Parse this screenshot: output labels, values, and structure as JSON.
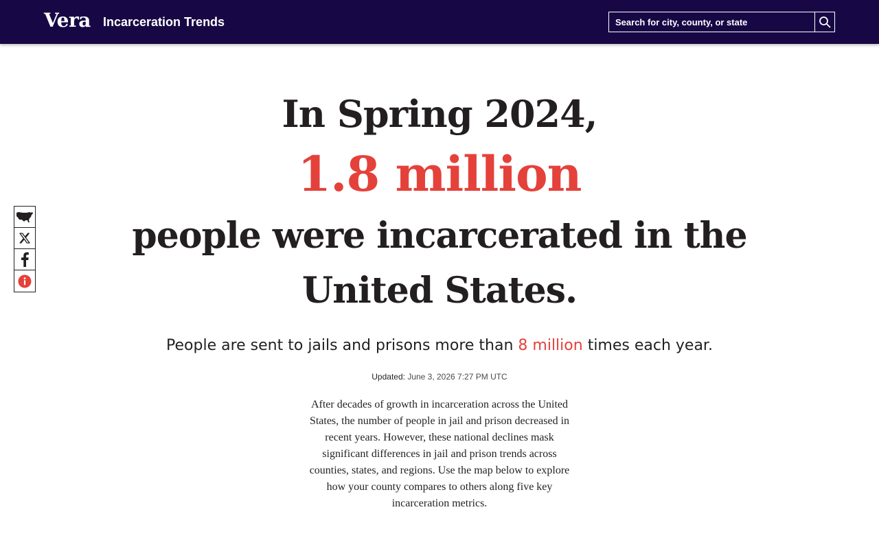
{
  "header": {
    "logo": "Vera",
    "site_title": "Incarceration Trends",
    "search_placeholder": "Search for city, county, or state"
  },
  "share_rail": {
    "items": [
      {
        "icon": "us-map-icon"
      },
      {
        "icon": "x-logo-icon"
      },
      {
        "icon": "facebook-icon"
      },
      {
        "icon": "info-icon",
        "color": "#e5413b"
      }
    ]
  },
  "hero": {
    "line1": "In Spring 2024,",
    "number": "1.8 million",
    "line3": "people were incarcerated in the United States.",
    "sub_pre": "People are sent to jails and prisons more than",
    "sub_accent": "8 million",
    "sub_post": "times each year.",
    "updated_label": "Updated:",
    "updated_value": "June 3, 2026 7:27 PM UTC",
    "intro": "After decades of growth in incarceration across the United States, the number of people in jail and prison decreased in recent years. However, these national declines mask significant differences in jail and prison trends across counties, states, and regions. Use the map below to explore how your county compares to others along five key incarceration metrics."
  },
  "colors": {
    "header_bg": "#170845",
    "accent": "#e5413b",
    "text": "#231f20"
  }
}
